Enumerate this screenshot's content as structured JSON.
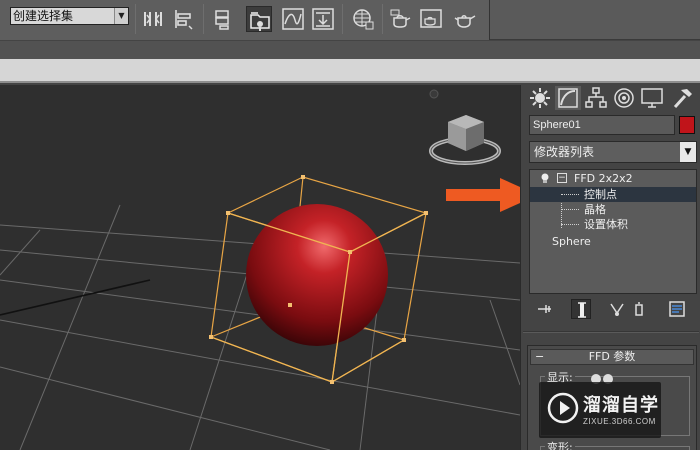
{
  "toolbar": {
    "selection_set": "创建选择集"
  },
  "panel": {
    "object_name": "Sphere01",
    "object_color": "#c0141a",
    "modifier_list": "修改器列表",
    "stack": {
      "modifier": "FFD 2x2x2",
      "subobjects": [
        "控制点",
        "晶格",
        "设置体积"
      ],
      "selected_subobject": "控制点",
      "base_object": "Sphere"
    },
    "rollout": {
      "title": "FFD 参数",
      "display_label": "显示:",
      "deform_label": "变形:"
    }
  },
  "viewport": {
    "sphere_color": "#b3181c",
    "lattice_color": "#e8a545",
    "annotation_arrow_color": "#ee5a22"
  },
  "watermark": {
    "title": "溜溜自学",
    "subtitle": "ZIXUE.3D66.COM"
  }
}
